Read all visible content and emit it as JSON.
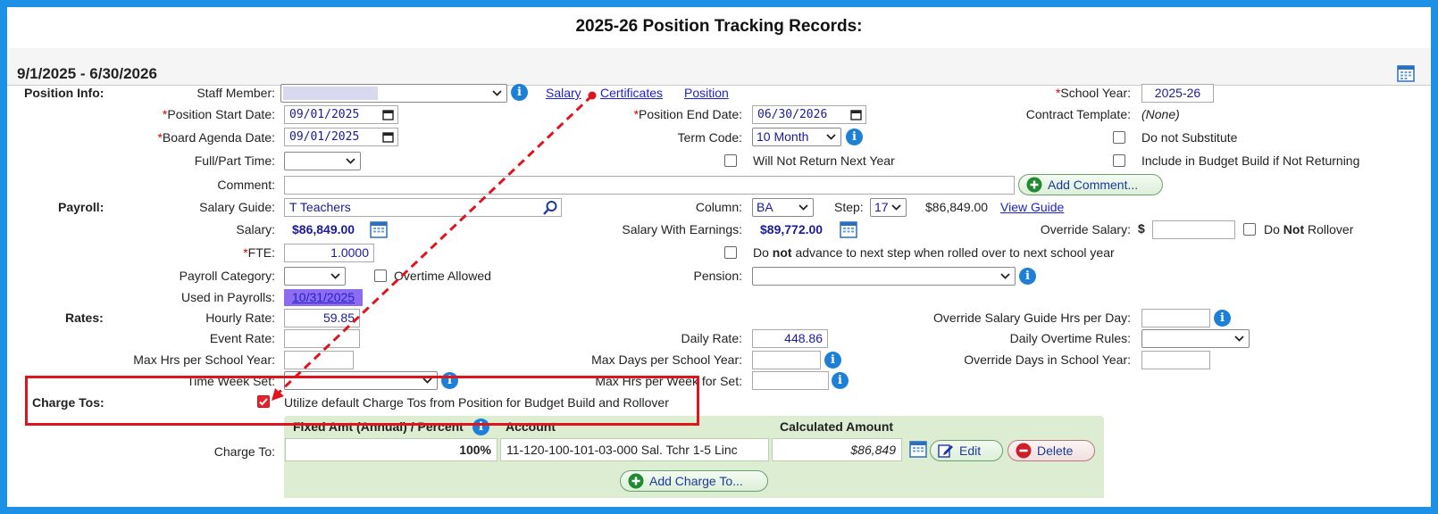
{
  "title": "2025-26 Position Tracking Records:",
  "date_range": "9/1/2025 - 6/30/2026",
  "position_info": {
    "section_label": "Position Info:",
    "staff_member_label": "Staff Member:",
    "links": [
      "Salary",
      "Certificates",
      "Position"
    ],
    "school_year_label": "School Year:",
    "school_year": "2025-26",
    "position_start_label": "Position Start Date:",
    "position_start": "09/01/2025",
    "position_end_label": "Position End Date:",
    "position_end": "06/30/2026",
    "contract_template_label": "Contract Template:",
    "contract_template": "(None)",
    "board_agenda_label": "Board Agenda Date:",
    "board_agenda": "09/01/2025",
    "term_code_label": "Term Code:",
    "term_code": "10 Month",
    "do_not_substitute": "Do not Substitute",
    "full_part_label": "Full/Part Time:",
    "will_not_return": "Will Not Return Next Year",
    "include_budget": "Include in Budget Build if Not Returning",
    "comment_label": "Comment:",
    "add_comment": "Add Comment..."
  },
  "payroll": {
    "section_label": "Payroll:",
    "salary_guide_label": "Salary Guide:",
    "salary_guide": "T Teachers",
    "column_label": "Column:",
    "column": "BA",
    "step_label": "Step:",
    "step": "17",
    "step_amount": "$86,849.00",
    "view_guide": "View Guide",
    "salary_label": "Salary:",
    "salary": "$86,849.00",
    "salary_earnings_label": "Salary With Earnings:",
    "salary_earnings": "$89,772.00",
    "override_salary_label": "Override Salary:",
    "dollar": "$",
    "do_label": "Do",
    "not_label": "Not",
    "rollover_label": "Rollover",
    "fte_label": "FTE:",
    "fte": "1.0000",
    "advance_pre": "Do",
    "advance_bold": "not",
    "advance_post": "advance to next step when rolled over to next school year",
    "payroll_category_label": "Payroll Category:",
    "overtime_allowed": "Overtime Allowed",
    "pension_label": "Pension:",
    "used_in_payrolls_label": "Used in Payrolls:",
    "used_in_payrolls": "10/31/2025"
  },
  "rates": {
    "section_label": "Rates:",
    "hourly_rate_label": "Hourly Rate:",
    "hourly_rate": "59.85",
    "override_hrs_label": "Override Salary Guide Hrs per Day:",
    "event_rate_label": "Event Rate:",
    "daily_rate_label": "Daily Rate:",
    "daily_rate": "448.86",
    "daily_overtime_label": "Daily Overtime Rules:",
    "max_hrs_label": "Max Hrs per School Year:",
    "max_days_label": "Max Days per School Year:",
    "override_days_label": "Override Days in School Year:",
    "time_week_label": "Time Week Set:",
    "max_hrs_week_label": "Max Hrs per Week for Set:"
  },
  "charge_tos": {
    "section_label": "Charge Tos:",
    "utilize_default": "Utilize default Charge Tos from Position for Budget Build and Rollover",
    "charge_to_label": "Charge To:",
    "headers": [
      "Fixed Amt (Annual) / Percent",
      "Account",
      "Calculated Amount"
    ],
    "row": {
      "percent": "100%",
      "account": "11-120-100-101-03-000 Sal. Tchr 1-5 Linc",
      "amount": "$86,849"
    },
    "edit": "Edit",
    "delete": "Delete",
    "add_charge": "Add Charge To..."
  },
  "colors": {
    "accent_border": "#1e90e6",
    "highlight": "#e0141c",
    "link": "#2222cc"
  }
}
